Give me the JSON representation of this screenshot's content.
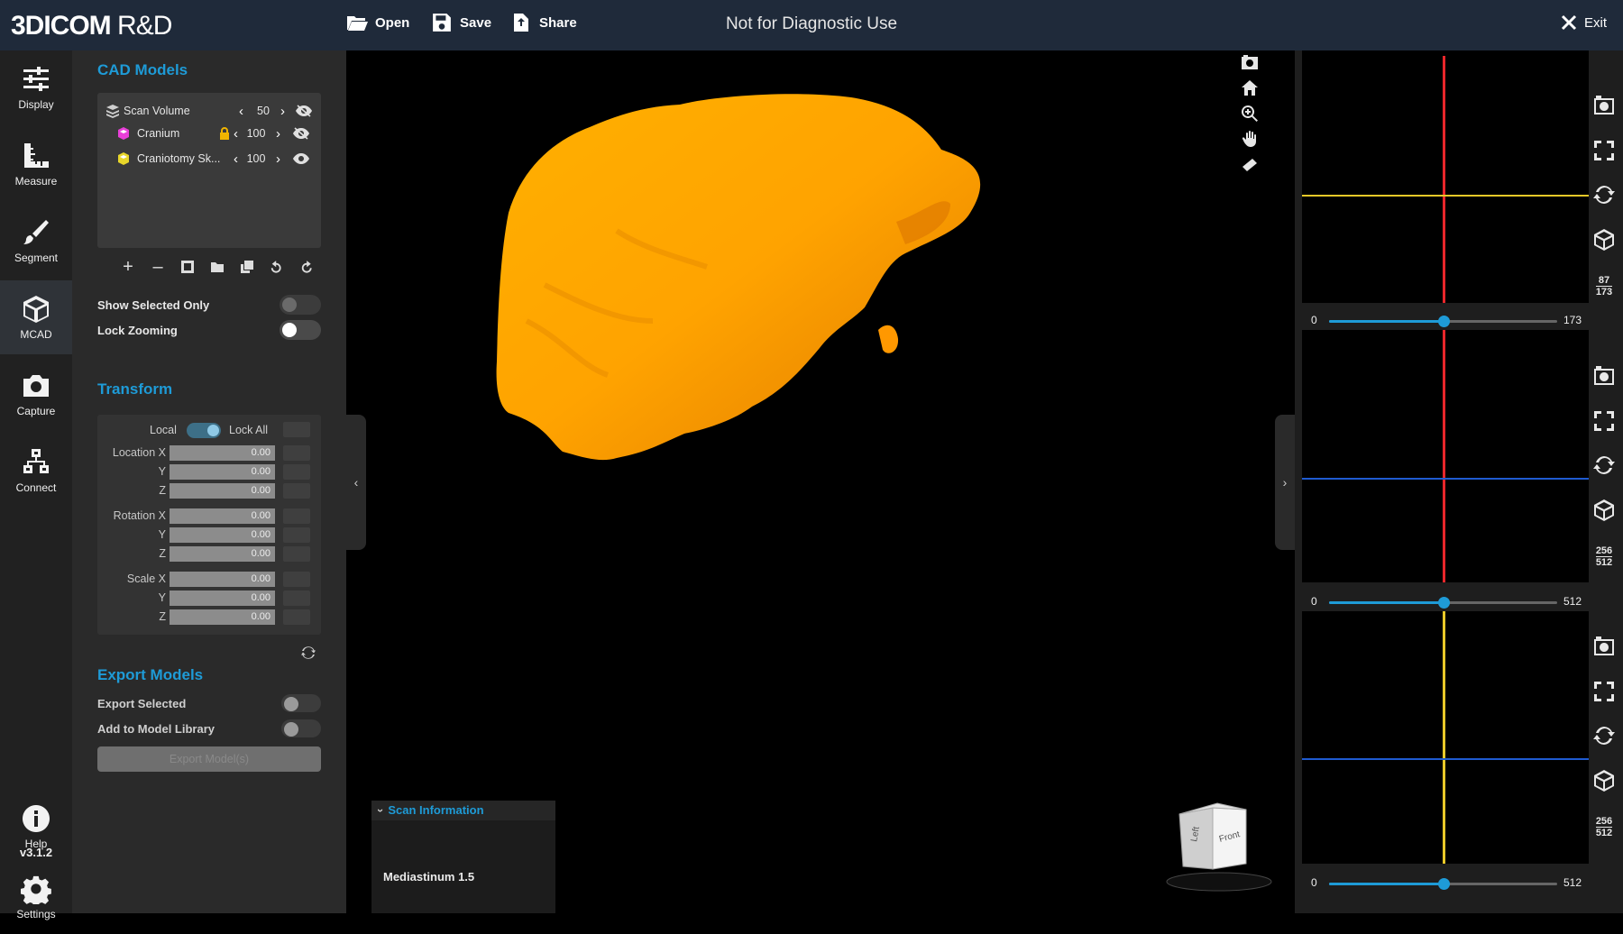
{
  "app": {
    "logo_main": "3DICOM",
    "logo_rd": "R&D",
    "title": "Not for Diagnostic Use",
    "exit_label": "Exit"
  },
  "toolbar": {
    "open_label": "Open",
    "save_label": "Save",
    "share_label": "Share"
  },
  "rail": {
    "items": [
      {
        "label": "Display",
        "icon": "sliders-icon"
      },
      {
        "label": "Measure",
        "icon": "ruler-icon"
      },
      {
        "label": "Segment",
        "icon": "brush-icon"
      },
      {
        "label": "MCAD",
        "icon": "cube-icon"
      },
      {
        "label": "Capture",
        "icon": "camera-icon"
      },
      {
        "label": "Connect",
        "icon": "network-icon"
      },
      {
        "label": "Help",
        "icon": "info-icon"
      },
      {
        "label": "Settings",
        "icon": "gear-icon"
      }
    ],
    "version": "v3.1.2"
  },
  "cad": {
    "title": "CAD Models",
    "models": [
      {
        "name": "Scan Volume",
        "value": "50",
        "color": "#cfcfcf"
      },
      {
        "name": "Cranium",
        "value": "100",
        "color": "#e83fd8"
      },
      {
        "name": "Craniotomy Sk...",
        "value": "100",
        "color": "#e8d62a"
      }
    ],
    "show_selected_only": "Show Selected Only",
    "lock_zooming": "Lock Zooming"
  },
  "transform": {
    "title": "Transform",
    "local_label": "Local",
    "lock_all_label": "Lock All",
    "location_label": "Location",
    "rotation_label": "Rotation",
    "scale_label": "Scale",
    "x": "X",
    "y": "Y",
    "z": "Z",
    "location": [
      "0.00",
      "0.00",
      "0.00"
    ],
    "rotation": [
      "0.00",
      "0.00",
      "0.00"
    ],
    "scale": [
      "0.00",
      "0.00",
      "0.00"
    ]
  },
  "export": {
    "title": "Export Models",
    "export_selected": "Export Selected",
    "add_to_library": "Add to Model Library",
    "button": "Export Model(s)"
  },
  "scan_info": {
    "header": "Scan Information",
    "value": "Mediastinum 1.5"
  },
  "orientation_cube": {
    "left": "Left",
    "front": "Front"
  },
  "slices": [
    {
      "min": "0",
      "max": "173",
      "position": 0.5,
      "frac_top": "87",
      "frac_bottom": "173"
    },
    {
      "min": "0",
      "max": "512",
      "position": 0.5,
      "frac_top": "256",
      "frac_bottom": "512"
    },
    {
      "min": "0",
      "max": "512",
      "position": 0.5,
      "frac_top": "256",
      "frac_bottom": "512"
    }
  ],
  "colors": {
    "accent": "#1e9bd7",
    "topbar": "#1f2a3a",
    "model": "#ffa500",
    "red_line": "#e8262a",
    "yellow_line": "#e8c828",
    "blue_line": "#1f5bd1"
  }
}
